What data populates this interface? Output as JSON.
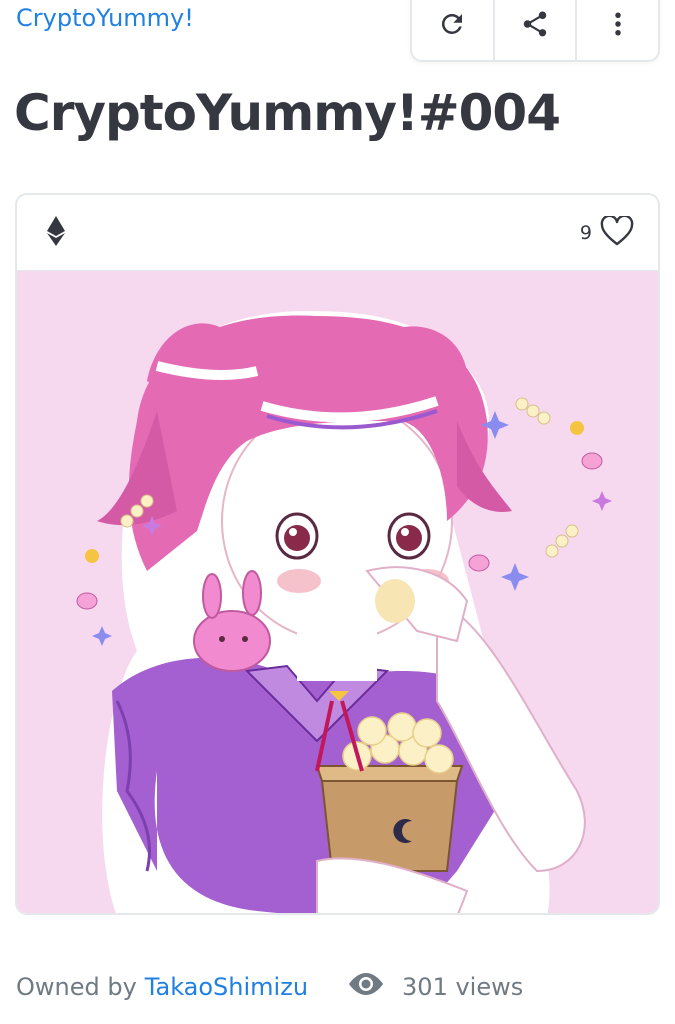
{
  "collection": {
    "name": "CryptoYummy!"
  },
  "item": {
    "title": "CryptoYummy!#004",
    "favorites": "9"
  },
  "actions": {
    "refresh_icon": "refresh-icon",
    "share_icon": "share-icon",
    "more_icon": "more-vertical-icon"
  },
  "card": {
    "chain_icon": "ethereum-icon",
    "favorite_icon": "heart-icon"
  },
  "footer": {
    "owned_by_label": "Owned by",
    "owner": "TakaoShimizu",
    "views": "301 views"
  },
  "colors": {
    "link": "#2081e2",
    "title": "#353840",
    "muted": "#707a83",
    "border": "#e5e8eb",
    "art_background": "#f6d9ef"
  }
}
